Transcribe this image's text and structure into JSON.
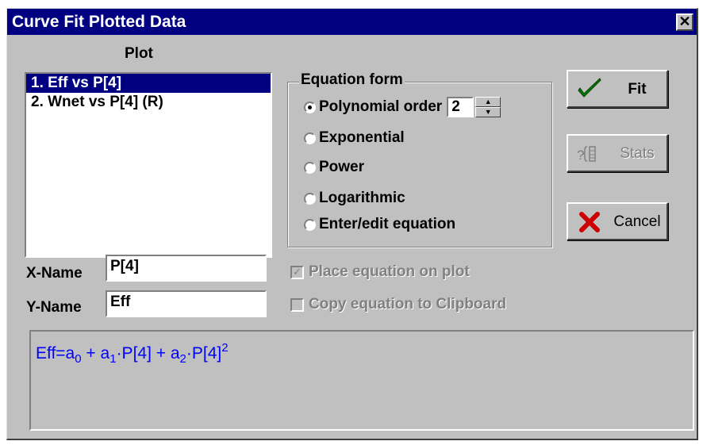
{
  "window": {
    "title": "Curve Fit Plotted Data",
    "close_glyph": "✕"
  },
  "plot": {
    "label": "Plot",
    "items": [
      {
        "text": "1.  Eff vs P[4]",
        "selected": true
      },
      {
        "text": "2.  Wnet vs P[4] (R)",
        "selected": false
      }
    ]
  },
  "equation_form": {
    "legend": "Equation form",
    "options": {
      "polynomial": "Polynomial order",
      "exponential": "Exponential",
      "power": "Power",
      "logarithmic": "Logarithmic",
      "enter_edit": "Enter/edit equation"
    },
    "selected": "polynomial",
    "polynomial_order": "2"
  },
  "buttons": {
    "fit": {
      "label": "Fit",
      "icon": "checkmark-icon",
      "icon_color": "#008000"
    },
    "stats": {
      "label": "Stats",
      "icon": "stats-icon",
      "enabled": false
    },
    "cancel": {
      "label": "Cancel",
      "icon": "x-icon",
      "icon_color": "#cc0000"
    }
  },
  "names": {
    "x_label": "X-Name",
    "x_value": "P[4]",
    "y_label": "Y-Name",
    "y_value": "Eff"
  },
  "options": {
    "place_on_plot": {
      "label": "Place equation on plot",
      "checked": true,
      "enabled": false
    },
    "copy_clipboard": {
      "label": "Copy equation to Clipboard",
      "checked": false,
      "enabled": false
    }
  },
  "equation": {
    "lhs": "Eff=a",
    "sub0": "0",
    "plus1": " + a",
    "sub1": "1",
    "term1": "·P[4] + a",
    "sub2": "2",
    "term2": "·P[4]",
    "sup2": "2",
    "color": "#0000ff"
  }
}
